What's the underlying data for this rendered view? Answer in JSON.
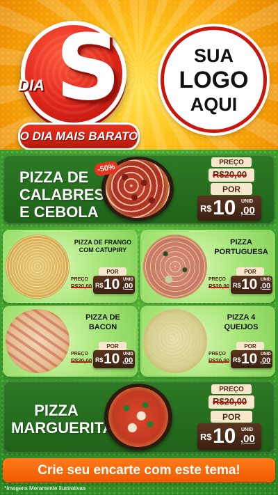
{
  "header": {
    "brand_small": "DIA",
    "brand_letter": "S",
    "brand_tagline": "O DIA MAIS BARATO",
    "logo_placeholder": [
      "SUA",
      "LOGO",
      "AQUI"
    ]
  },
  "featured": [
    {
      "name_lines": [
        "PIZZA DE",
        "CALABRESA",
        "E CEBOLA"
      ],
      "badge": "-50%",
      "price_label": "PREÇO",
      "old_price": "R$20,00",
      "now_label": "POR",
      "currency": "R$",
      "price_int": "10",
      "price_dec": ",00",
      "unit": "UNID"
    },
    {
      "name_lines": [
        "PIZZA",
        "MARGUERITA"
      ],
      "price_label": "PREÇO",
      "old_price": "R$20,00",
      "now_label": "POR",
      "currency": "R$",
      "price_int": "10",
      "price_dec": ",00",
      "unit": "UNID"
    }
  ],
  "items": [
    {
      "name_lines": [
        "PIZZA DE FRANGO",
        "COM CATUPIRY"
      ],
      "price_label": "PREÇO",
      "old_price": "R$20,00",
      "now_label": "POR",
      "currency": "R$",
      "price_int": "10",
      "price_dec": ",00",
      "unit": "UNID"
    },
    {
      "name_lines": [
        "PIZZA",
        "PORTUGUESA"
      ],
      "price_label": "PREÇO",
      "old_price": "R$20,00",
      "now_label": "POR",
      "currency": "R$",
      "price_int": "10",
      "price_dec": ",00",
      "unit": "UNID"
    },
    {
      "name_lines": [
        "PIZZA DE",
        "BACON"
      ],
      "price_label": "PREÇO",
      "old_price": "R$20,00",
      "now_label": "POR",
      "currency": "R$",
      "price_int": "10",
      "price_dec": ",00",
      "unit": "UNID"
    },
    {
      "name_lines": [
        "PIZZA 4",
        "QUEIJOS"
      ],
      "price_label": "PREÇO",
      "old_price": "R$20,00",
      "now_label": "POR",
      "currency": "R$",
      "price_int": "10",
      "price_dec": ",00",
      "unit": "UNID"
    }
  ],
  "cta": "Crie seu encarte com este tema!",
  "footnote": "*Imagens Meramente Ilustrativas",
  "colors": {
    "header_yellow": "#ffc21a",
    "brand_red": "#e0251a",
    "card_green_dark": "#2c7a25",
    "card_green_light": "#a8e67a",
    "price_brown": "#3b2012",
    "cta_orange": "#f05a00"
  }
}
